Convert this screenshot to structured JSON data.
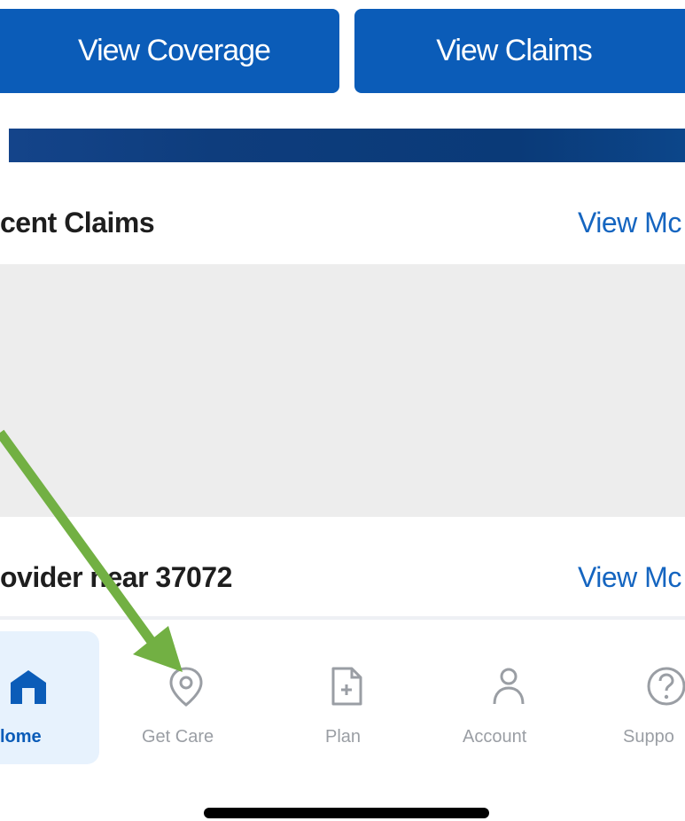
{
  "actions": {
    "view_coverage": "View Coverage",
    "view_claims": "View Claims"
  },
  "recent_claims": {
    "title": "cent Claims",
    "view_more": "View Mc"
  },
  "providers": {
    "title": "ovider",
    "title_rest": "near 37072",
    "view_more": "View Mc"
  },
  "bottom_nav": {
    "items": [
      {
        "label": "lome",
        "icon": "home-icon",
        "active": true
      },
      {
        "label": "Get Care",
        "icon": "map-pin-icon",
        "active": false
      },
      {
        "label": "Plan",
        "icon": "document-plus-icon",
        "active": false
      },
      {
        "label": "Account",
        "icon": "user-icon",
        "active": false
      },
      {
        "label": "Suppo",
        "icon": "help-circle-icon",
        "active": false
      }
    ]
  },
  "colors": {
    "primary": "#0b5cb8",
    "banner": "#0e3d7d",
    "link": "#1565c0",
    "nav_inactive": "#9a9ea4",
    "nav_active_bg": "#e7f2fd",
    "annotation_arrow": "#72b043"
  }
}
